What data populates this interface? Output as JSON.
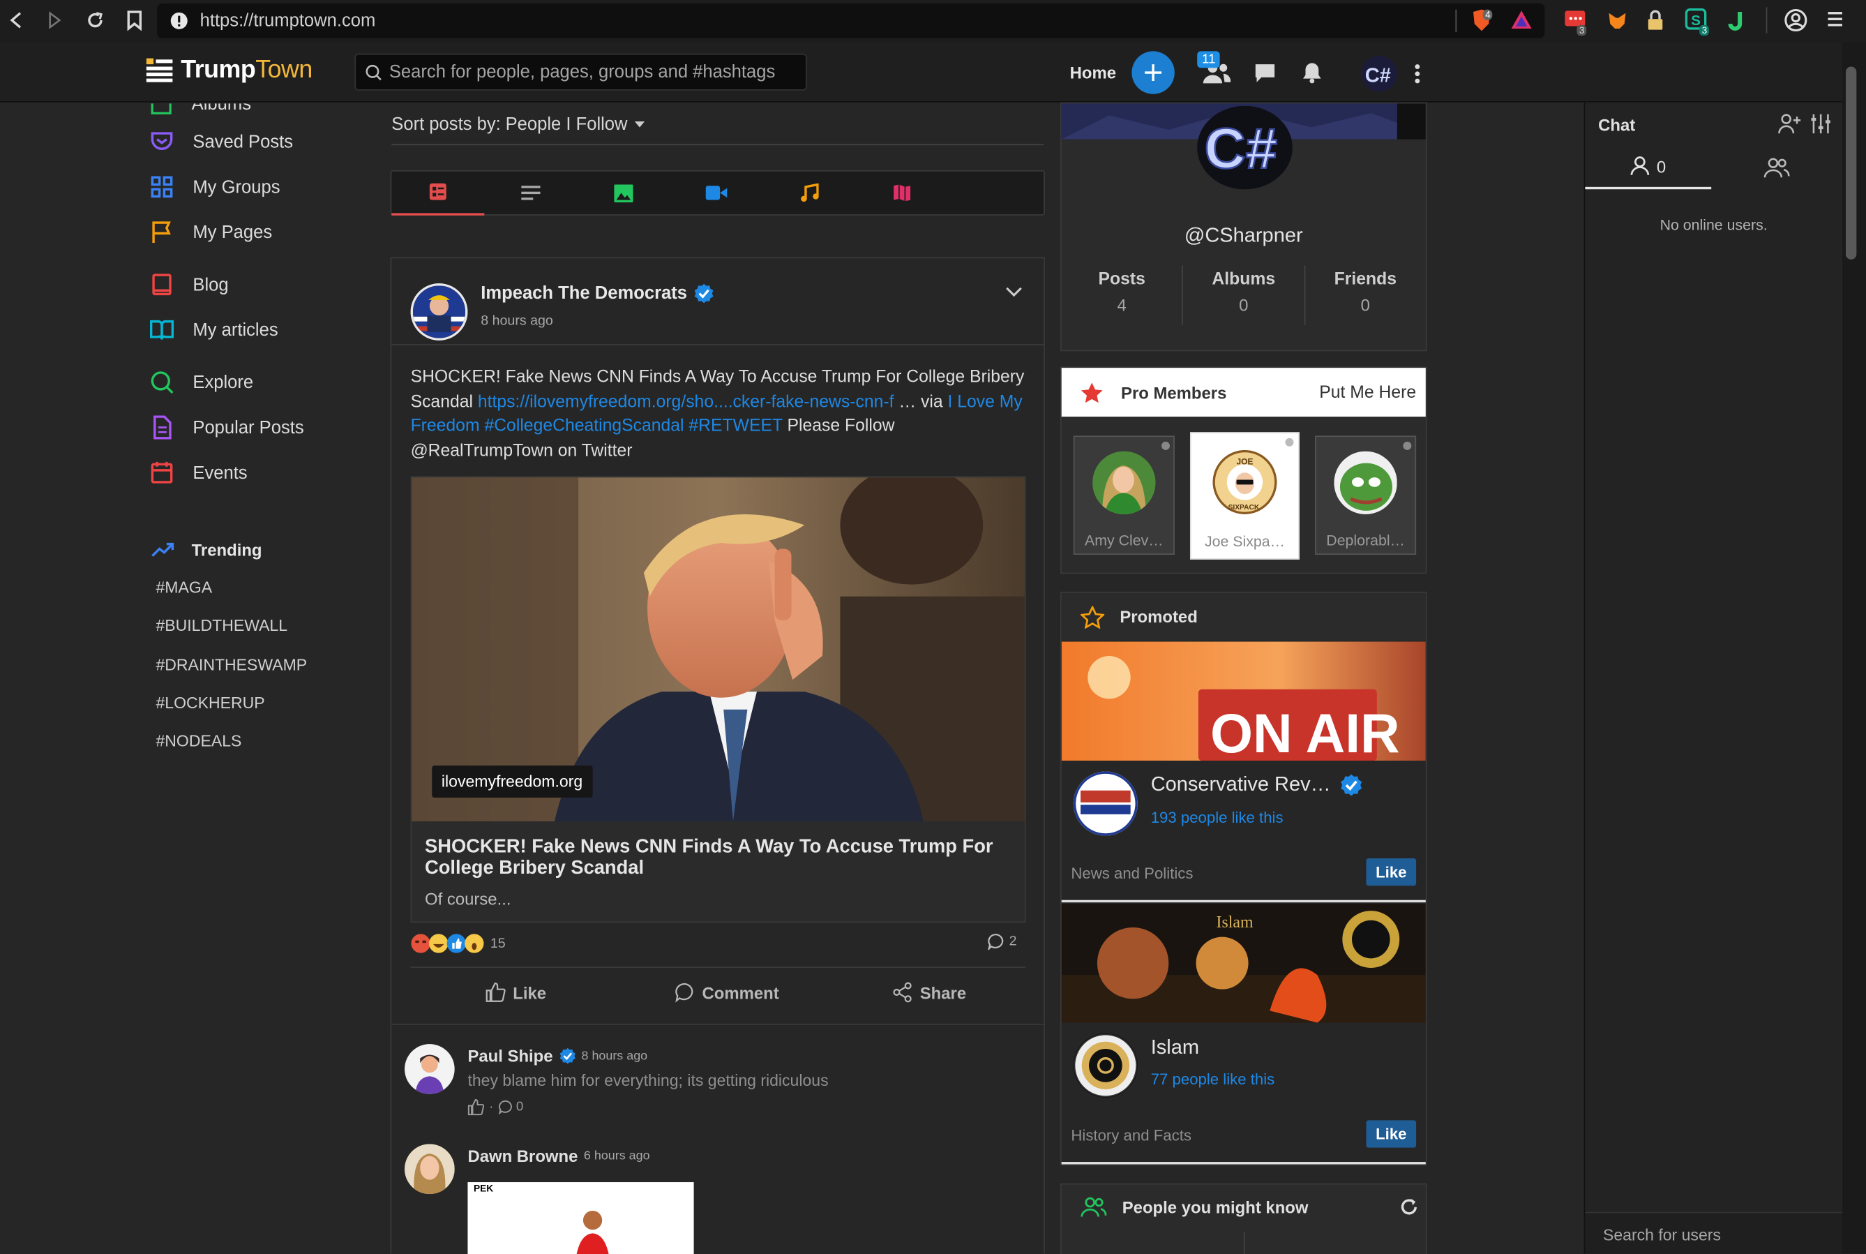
{
  "browser": {
    "url": "https://trumptown.com",
    "ext_badges": [
      "4",
      "3",
      "3"
    ]
  },
  "header": {
    "logo_trump": "Trump",
    "logo_town": "Town",
    "search_placeholder": "Search for people, pages, groups and #hashtags",
    "home": "Home",
    "friend_requests_badge": "11"
  },
  "sidebar": {
    "cut_item": "Albums",
    "items": [
      {
        "label": "Saved Posts",
        "icon": "bookmark-icon",
        "color": "#8b5cf6"
      },
      {
        "label": "My Groups",
        "icon": "grid-icon",
        "color": "#3b82f6"
      },
      {
        "label": "My Pages",
        "icon": "flag-icon",
        "color": "#f59e0b"
      },
      {
        "label": "Blog",
        "icon": "book-icon",
        "color": "#ef4444"
      },
      {
        "label": "My articles",
        "icon": "open-book-icon",
        "color": "#06b6d4"
      },
      {
        "label": "Explore",
        "icon": "search-icon",
        "color": "#22c55e"
      },
      {
        "label": "Popular Posts",
        "icon": "document-icon",
        "color": "#a855f7"
      },
      {
        "label": "Events",
        "icon": "calendar-icon",
        "color": "#ef4444"
      }
    ],
    "trending_title": "Trending",
    "trending_tags": [
      "#MAGA",
      "#BUILDTHEWALL",
      "#DRAINTHESWAMP",
      "#LOCKHERUP",
      "#NODEALS"
    ]
  },
  "feed": {
    "sort_label": "Sort posts by:",
    "sort_value": "People I Follow",
    "tabs": [
      "all-posts",
      "text",
      "photos",
      "videos",
      "music",
      "files"
    ],
    "post": {
      "author": "Impeach The Democrats",
      "time": "8 hours ago",
      "text_start": "SHOCKER! Fake News CNN Finds A Way To Accuse Trump For College Bribery Scandal ",
      "link": "https://ilovemyfreedom.org/sho....cker-fake-news-cnn-f",
      "ellipsis_via": " … via ",
      "via_link": "I Love My Freedom",
      "hashtags": " #CollegeCheatingScandal #RETWEET",
      "text_end": " Please Follow @RealTrumpTown on Twitter",
      "image_domain": "ilovemyfreedom.org",
      "preview_title": "SHOCKER! Fake News CNN Finds A Way To Accuse Trump For College Bribery Scandal",
      "preview_desc": "Of course...",
      "reaction_count": "15",
      "comment_count": "2",
      "actions": {
        "like": "Like",
        "comment": "Comment",
        "share": "Share"
      }
    },
    "comments": [
      {
        "author": "Paul Shipe",
        "time": "8 hours ago",
        "text": "they blame him for everything; its getting ridiculous",
        "replies": "0"
      },
      {
        "author": "Dawn Browne",
        "time": "6 hours ago"
      }
    ],
    "comment_image_text": "PEK"
  },
  "profile": {
    "handle": "@CSharpner",
    "stats": [
      {
        "label": "Posts",
        "value": "4"
      },
      {
        "label": "Albums",
        "value": "0"
      },
      {
        "label": "Friends",
        "value": "0"
      }
    ]
  },
  "pro_members": {
    "title": "Pro Members",
    "action": "Put Me Here",
    "members": [
      "Amy Clev…",
      "Joe Sixpa…",
      "Deplorabl…"
    ],
    "badge_text": [
      "JOE",
      "SIXPACK"
    ]
  },
  "promoted": {
    "title": "Promoted",
    "pages": [
      {
        "name": "Conservative Rev…",
        "likes": "193 people like this",
        "category": "News and Politics",
        "like": "Like",
        "banner_text": "ON AIR"
      },
      {
        "name": "Islam",
        "likes": "77 people like this",
        "category": "History and Facts",
        "like": "Like",
        "banner_text": "Islam"
      }
    ]
  },
  "people_you_might_know": {
    "title": "People you might know"
  },
  "chat": {
    "title": "Chat",
    "online_count": "0",
    "empty": "No online users.",
    "search_placeholder": "Search for users"
  },
  "colors": {
    "accent_blue": "#1d7fd1",
    "link": "#1e88e5",
    "logo_town": "#f3b73a",
    "pro_star": "#e53935"
  }
}
